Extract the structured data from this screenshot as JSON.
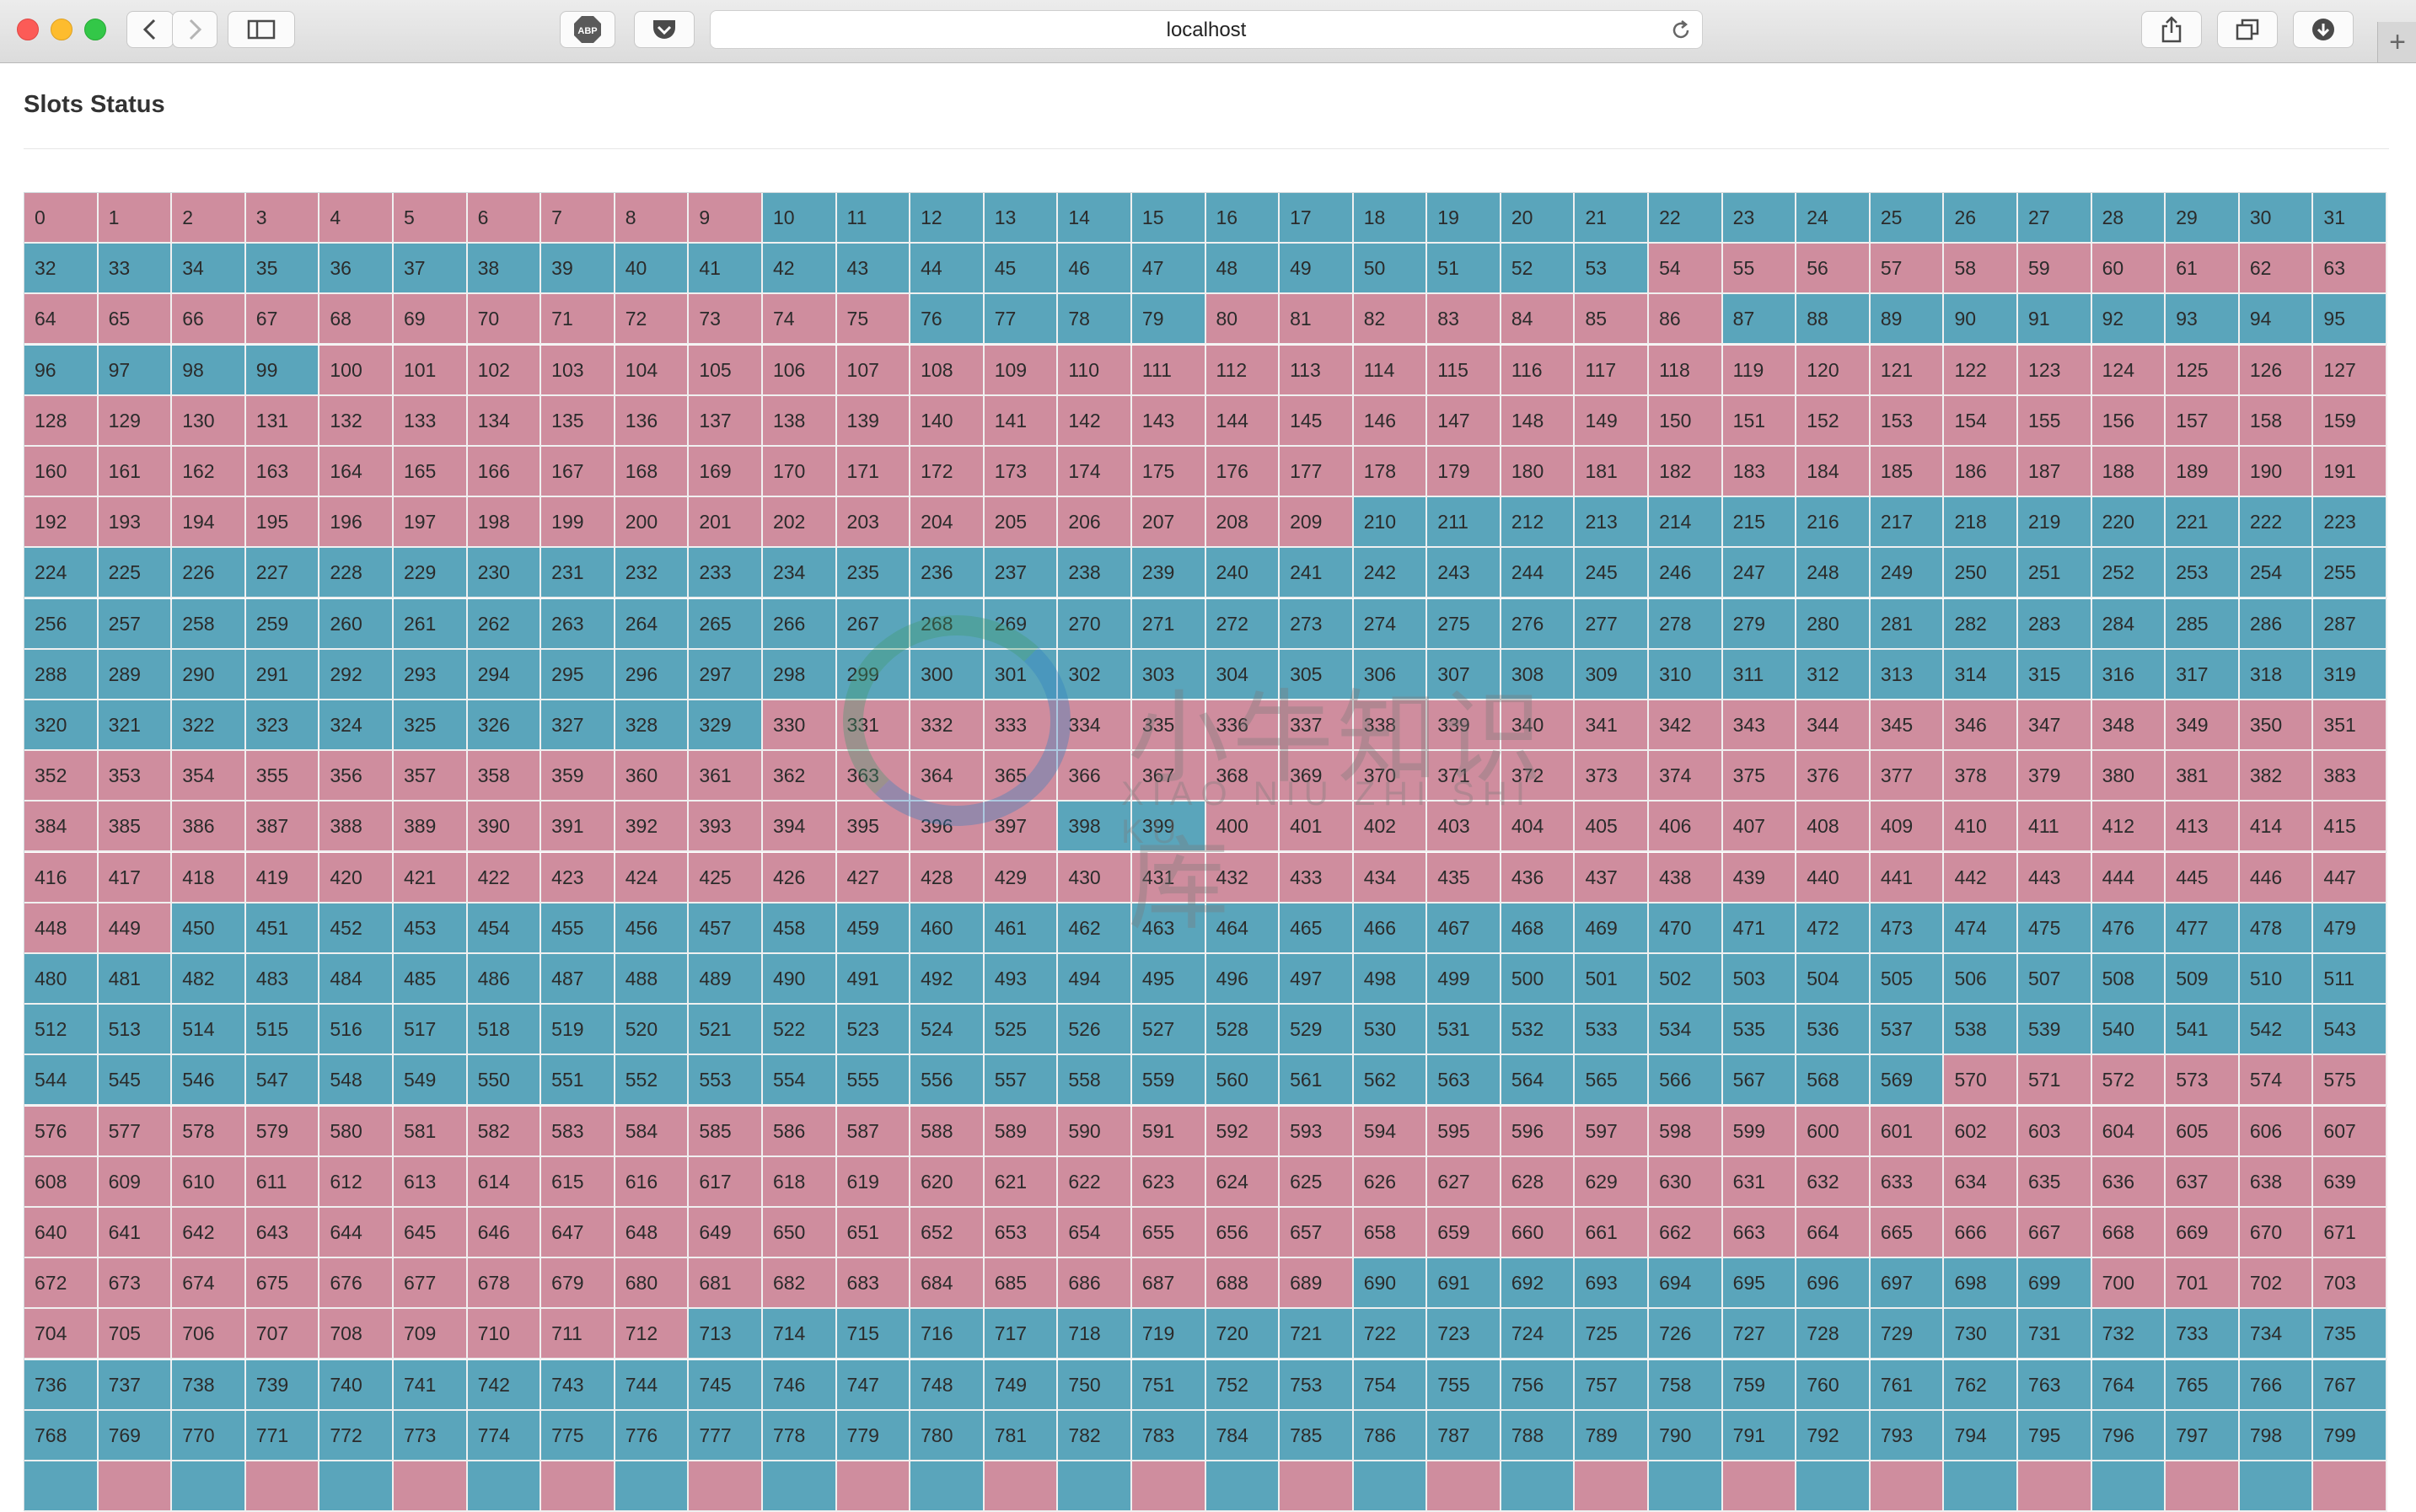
{
  "browser": {
    "url": "localhost",
    "buttons": {
      "back": "back",
      "forward": "forward",
      "sidebar": "sidebar",
      "adblock": "ABP",
      "pocket": "pocket",
      "share": "share",
      "tabs": "tabs",
      "downloads": "downloads",
      "new_tab": "+"
    }
  },
  "page": {
    "title": "Slots Status"
  },
  "slots": {
    "columns": 32,
    "visible_count": 800,
    "colors": {
      "pink": "#cf8d9e",
      "blue": "#5aa5bb"
    },
    "blue_ranges": [
      [
        10,
        53
      ],
      [
        76,
        79
      ],
      [
        87,
        99
      ],
      [
        210,
        329
      ],
      [
        398,
        399
      ],
      [
        450,
        569
      ],
      [
        690,
        699
      ],
      [
        713,
        799
      ]
    ],
    "pink_ranges": [
      [
        0,
        9
      ],
      [
        54,
        75
      ],
      [
        80,
        86
      ],
      [
        100,
        209
      ],
      [
        330,
        397
      ],
      [
        400,
        449
      ],
      [
        570,
        689
      ],
      [
        700,
        712
      ]
    ]
  },
  "watermark": {
    "cn": "小牛知识库",
    "en": "XIAO NIU ZHI SHI KU"
  }
}
